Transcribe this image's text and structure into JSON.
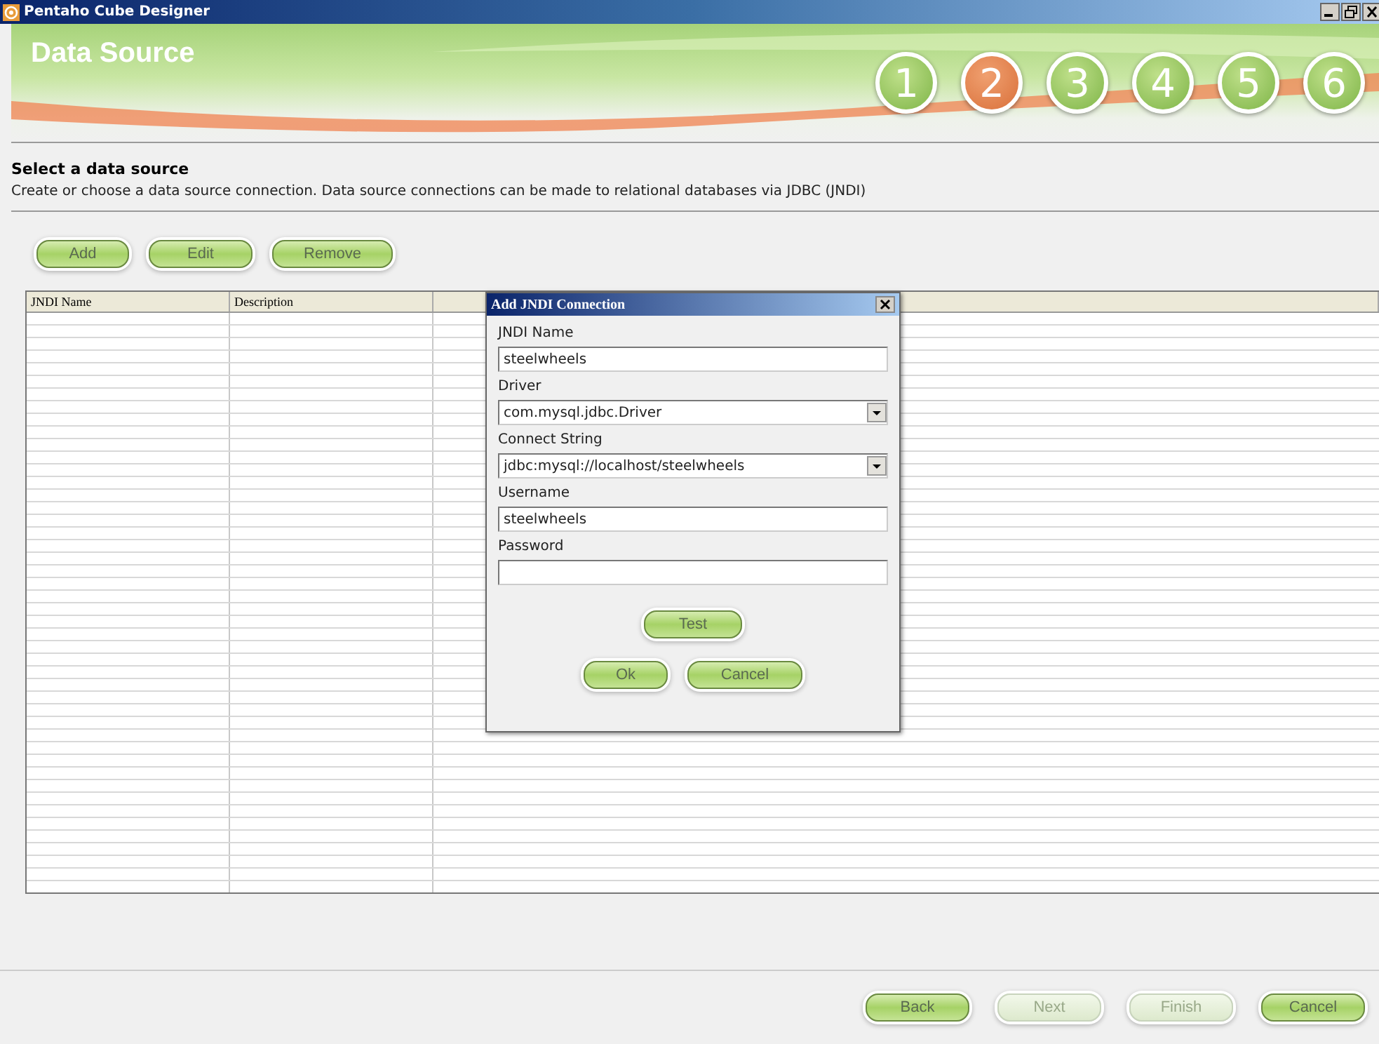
{
  "window": {
    "title": "Pentaho Cube Designer"
  },
  "header": {
    "title": "Data Source",
    "steps": [
      {
        "label": "1",
        "selected": false
      },
      {
        "label": "2",
        "selected": true
      },
      {
        "label": "3",
        "selected": false
      },
      {
        "label": "4",
        "selected": false
      },
      {
        "label": "5",
        "selected": false
      },
      {
        "label": "6",
        "selected": false
      }
    ]
  },
  "section": {
    "heading": "Select a data source",
    "description": "Create or choose a data source connection. Data source connections can be made to relational databases via JDBC (JNDI)"
  },
  "toolbar": [
    {
      "label": "Add",
      "disabled": false
    },
    {
      "label": "Edit",
      "disabled": false
    },
    {
      "label": "Remove",
      "disabled": false
    }
  ],
  "table": {
    "columns": [
      "JNDI Name",
      "Description",
      ""
    ]
  },
  "dialog": {
    "title": "Add JNDI Connection",
    "fields": [
      {
        "label": "JNDI Name",
        "kind": "text",
        "value": "steelwheels"
      },
      {
        "label": "Driver",
        "kind": "select",
        "value": "com.mysql.jdbc.Driver"
      },
      {
        "label": "Connect String",
        "kind": "select",
        "value": "jdbc:mysql://localhost/steelwheels"
      },
      {
        "label": "Username",
        "kind": "text",
        "value": "steelwheels"
      },
      {
        "label": "Password",
        "kind": "password"
      }
    ],
    "test_button": "Test",
    "buttons": [
      "Ok",
      "Cancel"
    ]
  },
  "footer": [
    {
      "label": "Back",
      "disabled": false
    },
    {
      "label": "Next",
      "disabled": true
    },
    {
      "label": "Finish",
      "disabled": true
    },
    {
      "label": "Cancel",
      "disabled": false
    }
  ]
}
